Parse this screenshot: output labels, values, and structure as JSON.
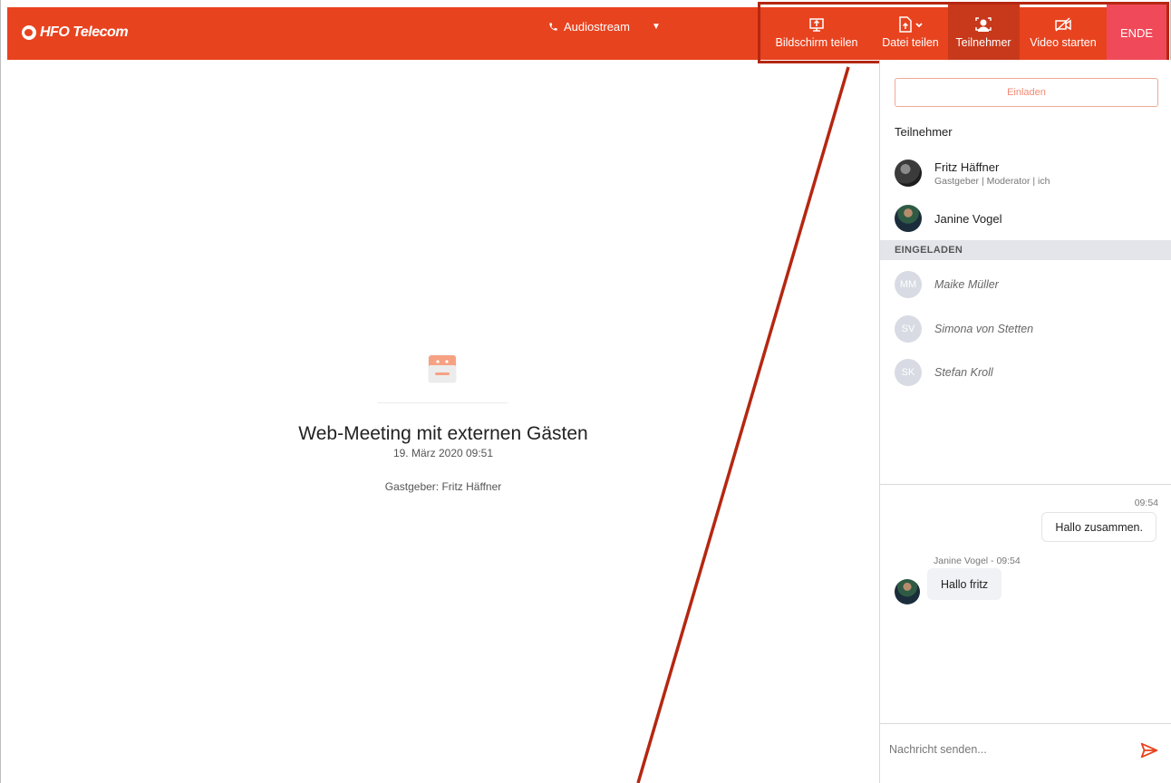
{
  "app": {
    "brand": "HFO Telecom",
    "accent": "#e8431f",
    "end_color": "#f04a5a"
  },
  "header": {
    "audio_label": "Audiostream",
    "audio_icon": "phone-icon",
    "toolbar": {
      "screen_share": "Bildschirm teilen",
      "file_share": "Datei teilen",
      "participants": "Teilnehmer",
      "video": "Video starten",
      "end": "ENDE"
    }
  },
  "meeting": {
    "title": "Web-Meeting mit externen Gästen",
    "date": "19. März 2020 09:51",
    "host": "Gastgeber: Fritz Häffner"
  },
  "panel": {
    "invite_button": "Einladen",
    "participants_title": "Teilnehmer",
    "participants": [
      {
        "name": "Fritz Häffner",
        "role": "Gastgeber | Moderator | ich"
      },
      {
        "name": "Janine Vogel"
      }
    ],
    "invited_title": "EINGELADEN",
    "invited": [
      {
        "initials": "MM",
        "name": "Maike Müller"
      },
      {
        "initials": "SV",
        "name": "Simona von Stetten"
      },
      {
        "initials": "SK",
        "name": "Stefan Kroll"
      }
    ]
  },
  "chat": {
    "messages": [
      {
        "time": "09:54",
        "text": "Hallo zusammen."
      },
      {
        "meta": "Janine Vogel - 09:54",
        "text": "Hallo fritz"
      }
    ],
    "input_placeholder": "Nachricht senden..."
  }
}
